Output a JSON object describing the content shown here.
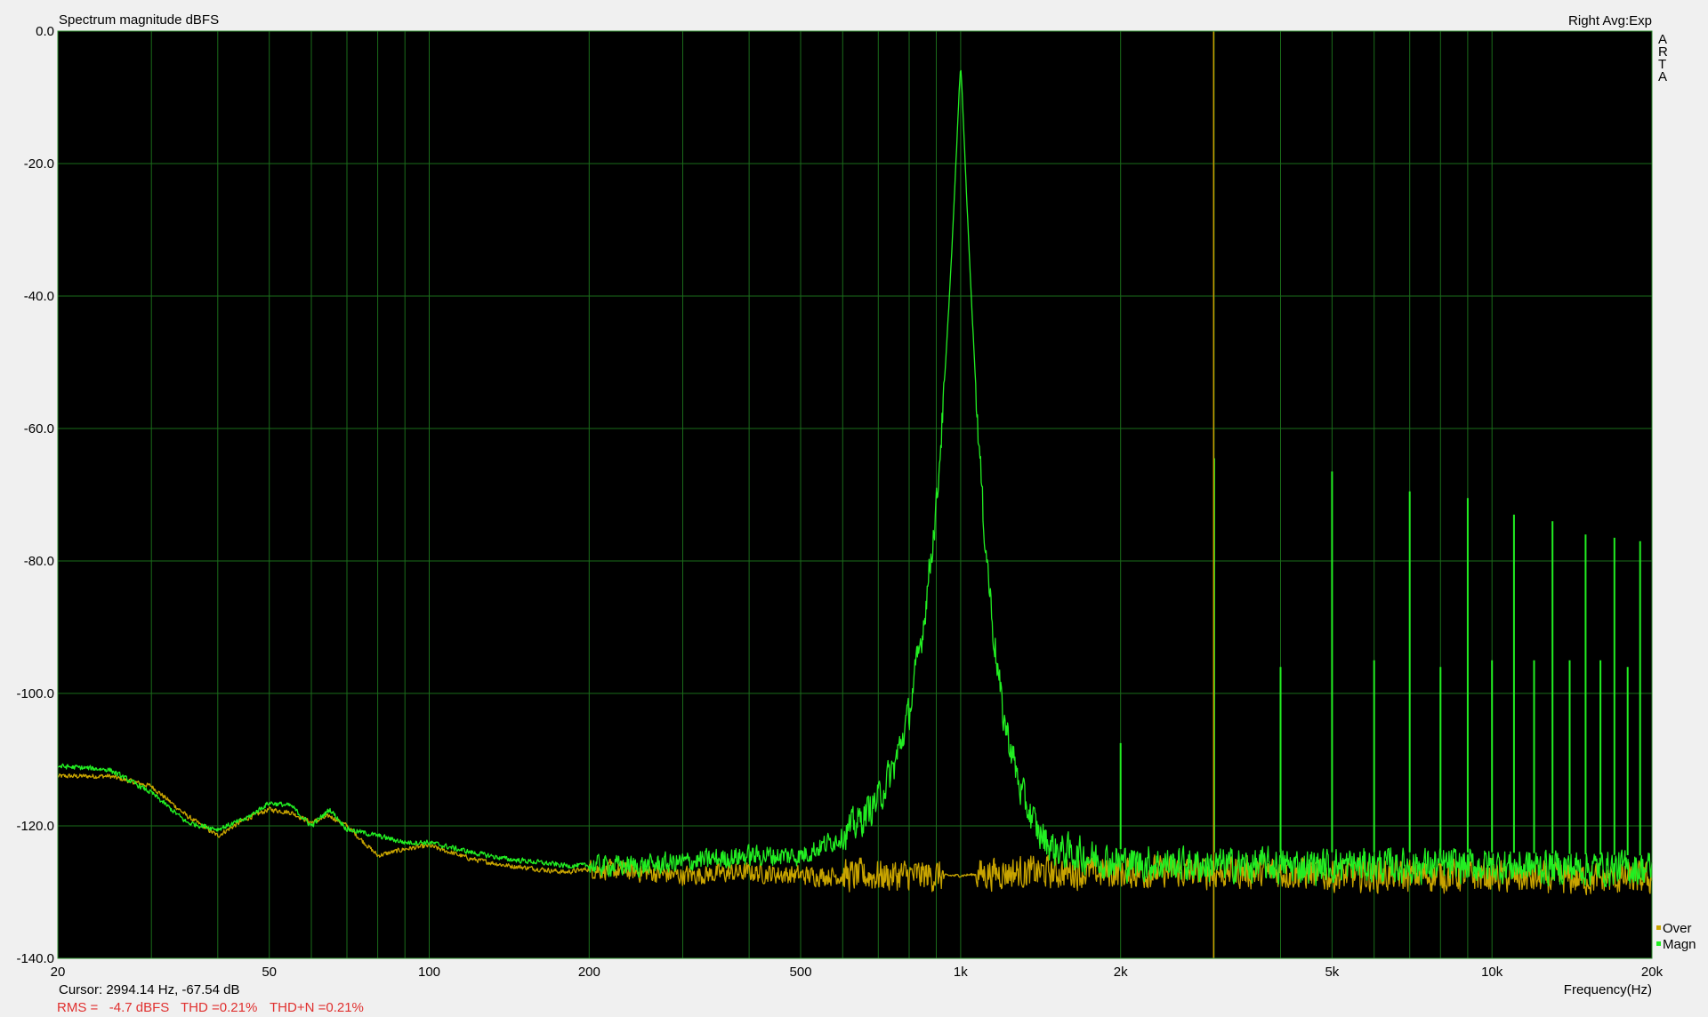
{
  "chart_data": {
    "type": "line",
    "title": "Spectrum magnitude dBFS",
    "channel_info": "Right Avg:Exp",
    "brand_letters": [
      "A",
      "R",
      "T",
      "A"
    ],
    "xlabel": "Frequency(Hz)",
    "ylabel": "",
    "x_scale": "log",
    "xlim": [
      20,
      20000
    ],
    "ylim": [
      -140,
      0
    ],
    "grid": true,
    "legend_position": "bottom-right",
    "x_ticks": [
      {
        "value": 20,
        "label": "20"
      },
      {
        "value": 50,
        "label": "50"
      },
      {
        "value": 100,
        "label": "100"
      },
      {
        "value": 200,
        "label": "200"
      },
      {
        "value": 500,
        "label": "500"
      },
      {
        "value": 1000,
        "label": "1k"
      },
      {
        "value": 2000,
        "label": "2k"
      },
      {
        "value": 5000,
        "label": "5k"
      },
      {
        "value": 10000,
        "label": "10k"
      },
      {
        "value": 20000,
        "label": "20k"
      }
    ],
    "y_ticks": [
      {
        "value": 0,
        "label": "0.0"
      },
      {
        "value": -20,
        "label": "-20.0"
      },
      {
        "value": -40,
        "label": "-40.0"
      },
      {
        "value": -60,
        "label": "-60.0"
      },
      {
        "value": -80,
        "label": "-80.0"
      },
      {
        "value": -100,
        "label": "-100.0"
      },
      {
        "value": -120,
        "label": "-120.0"
      },
      {
        "value": -140,
        "label": "-140.0"
      }
    ],
    "cursor": {
      "x": 2994.14,
      "label": "Cursor: 2994.14 Hz, -67.54 dB",
      "color": "#c8a000"
    },
    "status": {
      "rms": "RMS =   -4.7 dBFS",
      "thd": "THD =0.21%",
      "thdn": "THD+N =0.21%"
    },
    "colors": {
      "background": "#000000",
      "grid": "#1a6b1a",
      "frame": "#2f8f2f",
      "magn": "#22ee22",
      "over": "#c8a400",
      "status": "#e0302f"
    },
    "series": [
      {
        "name": "Over",
        "color": "#c8a400",
        "x": [
          20,
          25,
          30,
          35,
          40,
          45,
          50,
          55,
          60,
          65,
          70,
          80,
          90,
          100,
          120,
          140,
          160,
          180,
          200,
          250,
          300,
          400,
          500,
          600,
          700,
          800,
          900,
          1000,
          1200,
          1500,
          2000,
          3000,
          4000,
          5000,
          6000,
          7000,
          8000,
          10000,
          12000,
          15000,
          20000
        ],
        "y": [
          -112.5,
          -112.5,
          -114.0,
          -118.5,
          -121.5,
          -119.0,
          -117.5,
          -118.0,
          -119.5,
          -118.5,
          -120.0,
          -124.5,
          -123.5,
          -123.0,
          -125.0,
          -126.0,
          -126.5,
          -127.0,
          -126.5,
          -127.0,
          -127.5,
          -127.0,
          -127.5,
          -127.5,
          -127.5,
          -127.5,
          -127.5,
          -127.5,
          -127.0,
          -127.0,
          -127.0,
          -127.0,
          -127.0,
          -127.5,
          -127.5,
          -127.5,
          -127.5,
          -127.5,
          -128.0,
          -128.0,
          -128.0
        ],
        "noise": 2.2
      },
      {
        "name": "Magn",
        "color": "#22ee22",
        "x": [
          20,
          25,
          30,
          35,
          40,
          45,
          50,
          55,
          60,
          65,
          70,
          80,
          90,
          100,
          120,
          140,
          160,
          180,
          200,
          250,
          300,
          400,
          500,
          550,
          600,
          650,
          700,
          750,
          800,
          850,
          900,
          930,
          960,
          980,
          990,
          995,
          1000,
          1005,
          1010,
          1020,
          1040,
          1070,
          1100,
          1150,
          1200,
          1300,
          1400,
          1500,
          1700,
          2000,
          3000,
          5000,
          10000,
          20000
        ],
        "y": [
          -111.0,
          -111.5,
          -115.0,
          -119.5,
          -120.5,
          -119.0,
          -116.5,
          -117.0,
          -120.0,
          -117.5,
          -120.5,
          -121.5,
          -122.5,
          -122.5,
          -124.0,
          -125.0,
          -125.5,
          -126.0,
          -126.0,
          -126.0,
          -125.5,
          -124.5,
          -124.5,
          -123.0,
          -121.5,
          -119.0,
          -116.0,
          -111.0,
          -103.0,
          -90.0,
          -72.0,
          -55.0,
          -35.0,
          -20.0,
          -12.0,
          -8.0,
          -5.3,
          -8.0,
          -12.0,
          -20.0,
          -35.0,
          -55.0,
          -72.0,
          -90.0,
          -103.0,
          -115.0,
          -121.0,
          -123.5,
          -124.5,
          -125.5,
          -126.0,
          -126.0,
          -126.0,
          -126.5
        ],
        "noise": 2.4,
        "harmonics": [
          {
            "x": 2000,
            "y": -107.5
          },
          {
            "x": 3000,
            "y": -64.5
          },
          {
            "x": 4000,
            "y": -96.0
          },
          {
            "x": 5000,
            "y": -66.5
          },
          {
            "x": 6000,
            "y": -95.0
          },
          {
            "x": 7000,
            "y": -69.5
          },
          {
            "x": 8000,
            "y": -96.0
          },
          {
            "x": 9000,
            "y": -70.5
          },
          {
            "x": 10000,
            "y": -95.0
          },
          {
            "x": 11000,
            "y": -73.0
          },
          {
            "x": 12000,
            "y": -95.0
          },
          {
            "x": 13000,
            "y": -74.0
          },
          {
            "x": 14000,
            "y": -95.0
          },
          {
            "x": 15000,
            "y": -76.0
          },
          {
            "x": 16000,
            "y": -95.0
          },
          {
            "x": 17000,
            "y": -76.5
          },
          {
            "x": 18000,
            "y": -96.0
          },
          {
            "x": 19000,
            "y": -77.0
          }
        ]
      }
    ]
  }
}
